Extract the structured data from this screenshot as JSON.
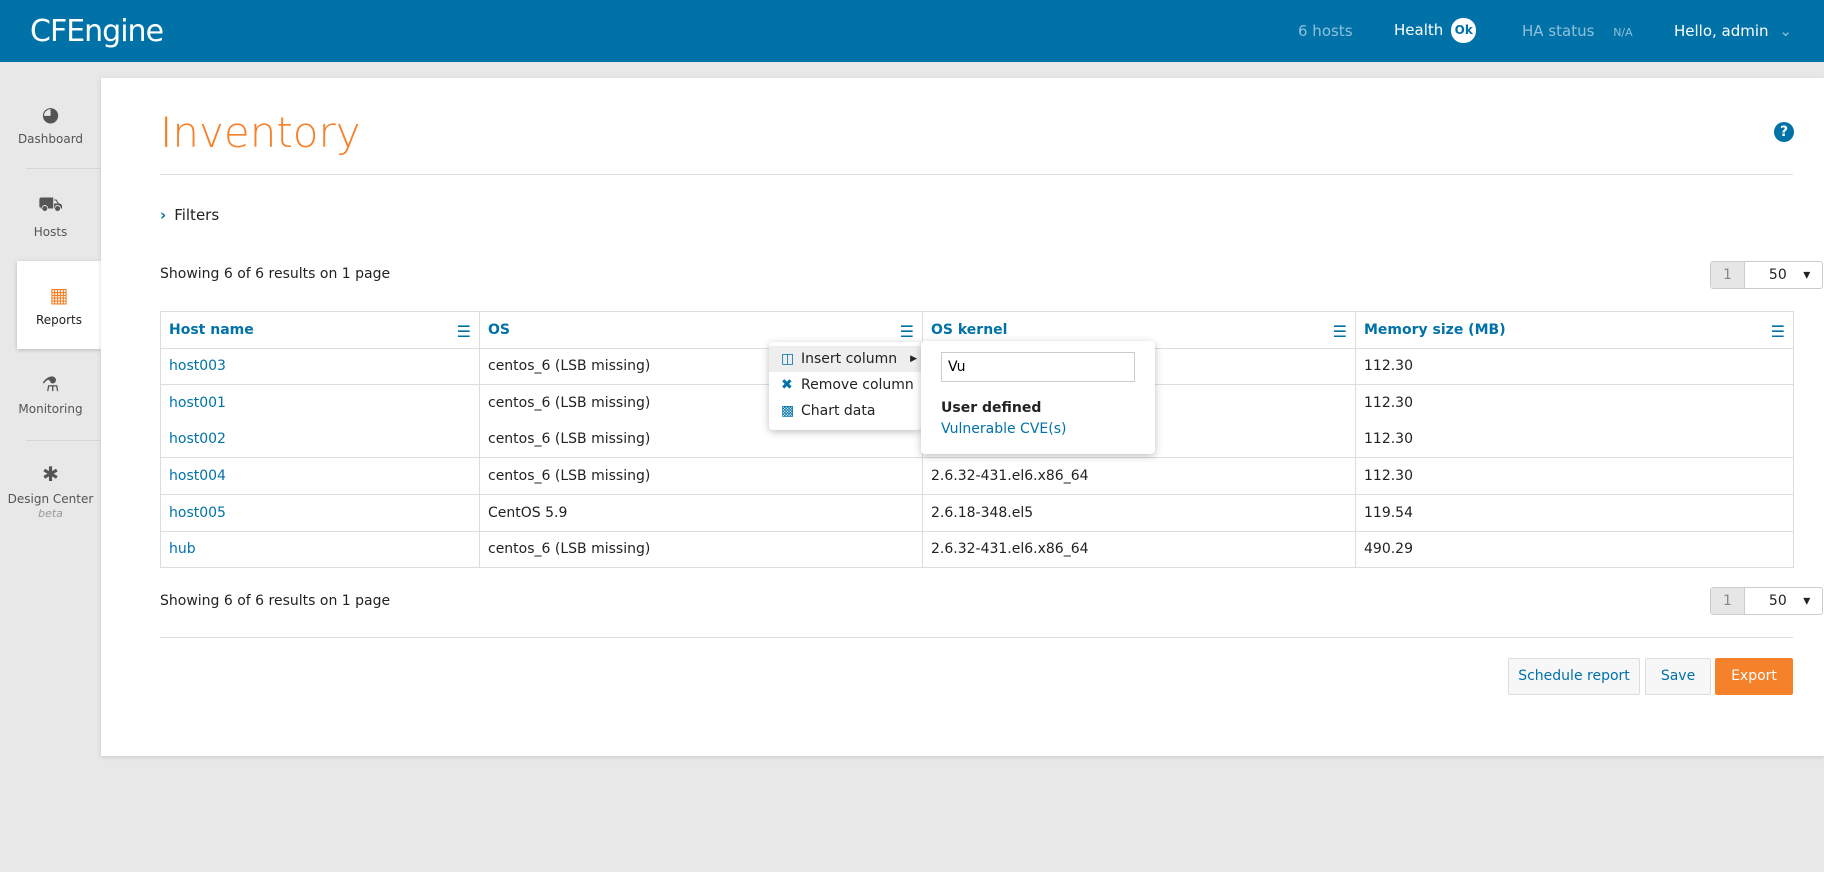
{
  "header": {
    "logo": "CFEngine",
    "hosts": "6 hosts",
    "health_label": "Health",
    "health_badge": "Ok",
    "ha_label": "HA status",
    "ha_value": "N/A",
    "user": "Hello, admin"
  },
  "sidebar": {
    "items": [
      {
        "label": "Dashboard",
        "icon": "dashboard-icon"
      },
      {
        "label": "Hosts",
        "icon": "sitemap-icon"
      },
      {
        "label": "Reports",
        "icon": "table-icon",
        "active": true
      },
      {
        "label": "Monitoring",
        "icon": "stethoscope-icon"
      },
      {
        "label": "Design Center",
        "sub": "beta",
        "icon": "puzzle-icon"
      }
    ]
  },
  "page": {
    "title": "Inventory",
    "filters": "Filters",
    "showing": "Showing 6 of 6 results on 1 page",
    "page": "1",
    "per_page": "50"
  },
  "table": {
    "headers": [
      "Host name",
      "OS",
      "OS kernel",
      "Memory size (MB)"
    ],
    "rows": [
      [
        "host003",
        "centos_6 (LSB missing)",
        "",
        "112.30"
      ],
      [
        "host001",
        "centos_6 (LSB missing)",
        "",
        "112.30"
      ],
      [
        "host002",
        "centos_6 (LSB missing)",
        "",
        "112.30"
      ],
      [
        "host004",
        "centos_6 (LSB missing)",
        "2.6.32-431.el6.x86_64",
        "112.30"
      ],
      [
        "host005",
        "CentOS 5.9",
        "2.6.18-348.el5",
        "119.54"
      ],
      [
        "hub",
        "centos_6 (LSB missing)",
        "2.6.32-431.el6.x86_64",
        "490.29"
      ]
    ]
  },
  "context_menu": {
    "items": [
      "Insert column",
      "Remove column",
      "Chart data"
    ]
  },
  "submenu": {
    "search_value": "Vu",
    "group": "User defined",
    "option": "Vulnerable CVE(s)"
  },
  "actions": {
    "schedule": "Schedule report",
    "save": "Save",
    "export": "Export"
  },
  "colors": {
    "brand": "#0072a8",
    "accent": "#f5822a"
  }
}
